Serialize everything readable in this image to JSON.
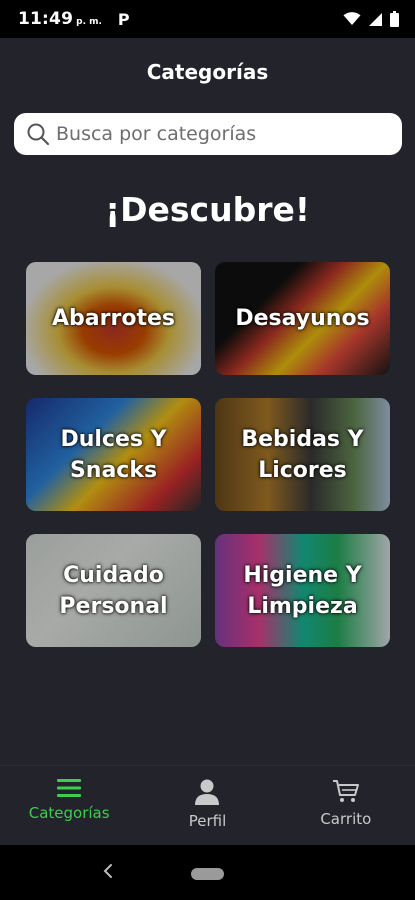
{
  "status_bar": {
    "time": "11:49",
    "ampm": "p. m.",
    "notification": "P"
  },
  "header": {
    "title": "Categorías"
  },
  "search": {
    "placeholder": "Busca por categorías"
  },
  "discover": {
    "title": "¡Descubre!"
  },
  "categories": [
    {
      "label": "Abarrotes",
      "icon": "groceries-image"
    },
    {
      "label": "Desayunos",
      "icon": "breakfast-image"
    },
    {
      "label": "Dulces Y\nSnacks",
      "icon": "snacks-image"
    },
    {
      "label": "Bebidas Y\nLicores",
      "icon": "beverages-image"
    },
    {
      "label": "Cuidado\nPersonal",
      "icon": "personal-care-image"
    },
    {
      "label": "Higiene Y\nLimpieza",
      "icon": "cleaning-image"
    }
  ],
  "bottom_nav": {
    "items": [
      {
        "label": "Categorías",
        "icon": "menu-icon",
        "active": true
      },
      {
        "label": "Perfil",
        "icon": "person-icon",
        "active": false
      },
      {
        "label": "Carrito",
        "icon": "cart-icon",
        "active": false
      }
    ]
  },
  "colors": {
    "background": "#22232b",
    "accent": "#3ccf4e",
    "search_bg": "#ffffff"
  }
}
